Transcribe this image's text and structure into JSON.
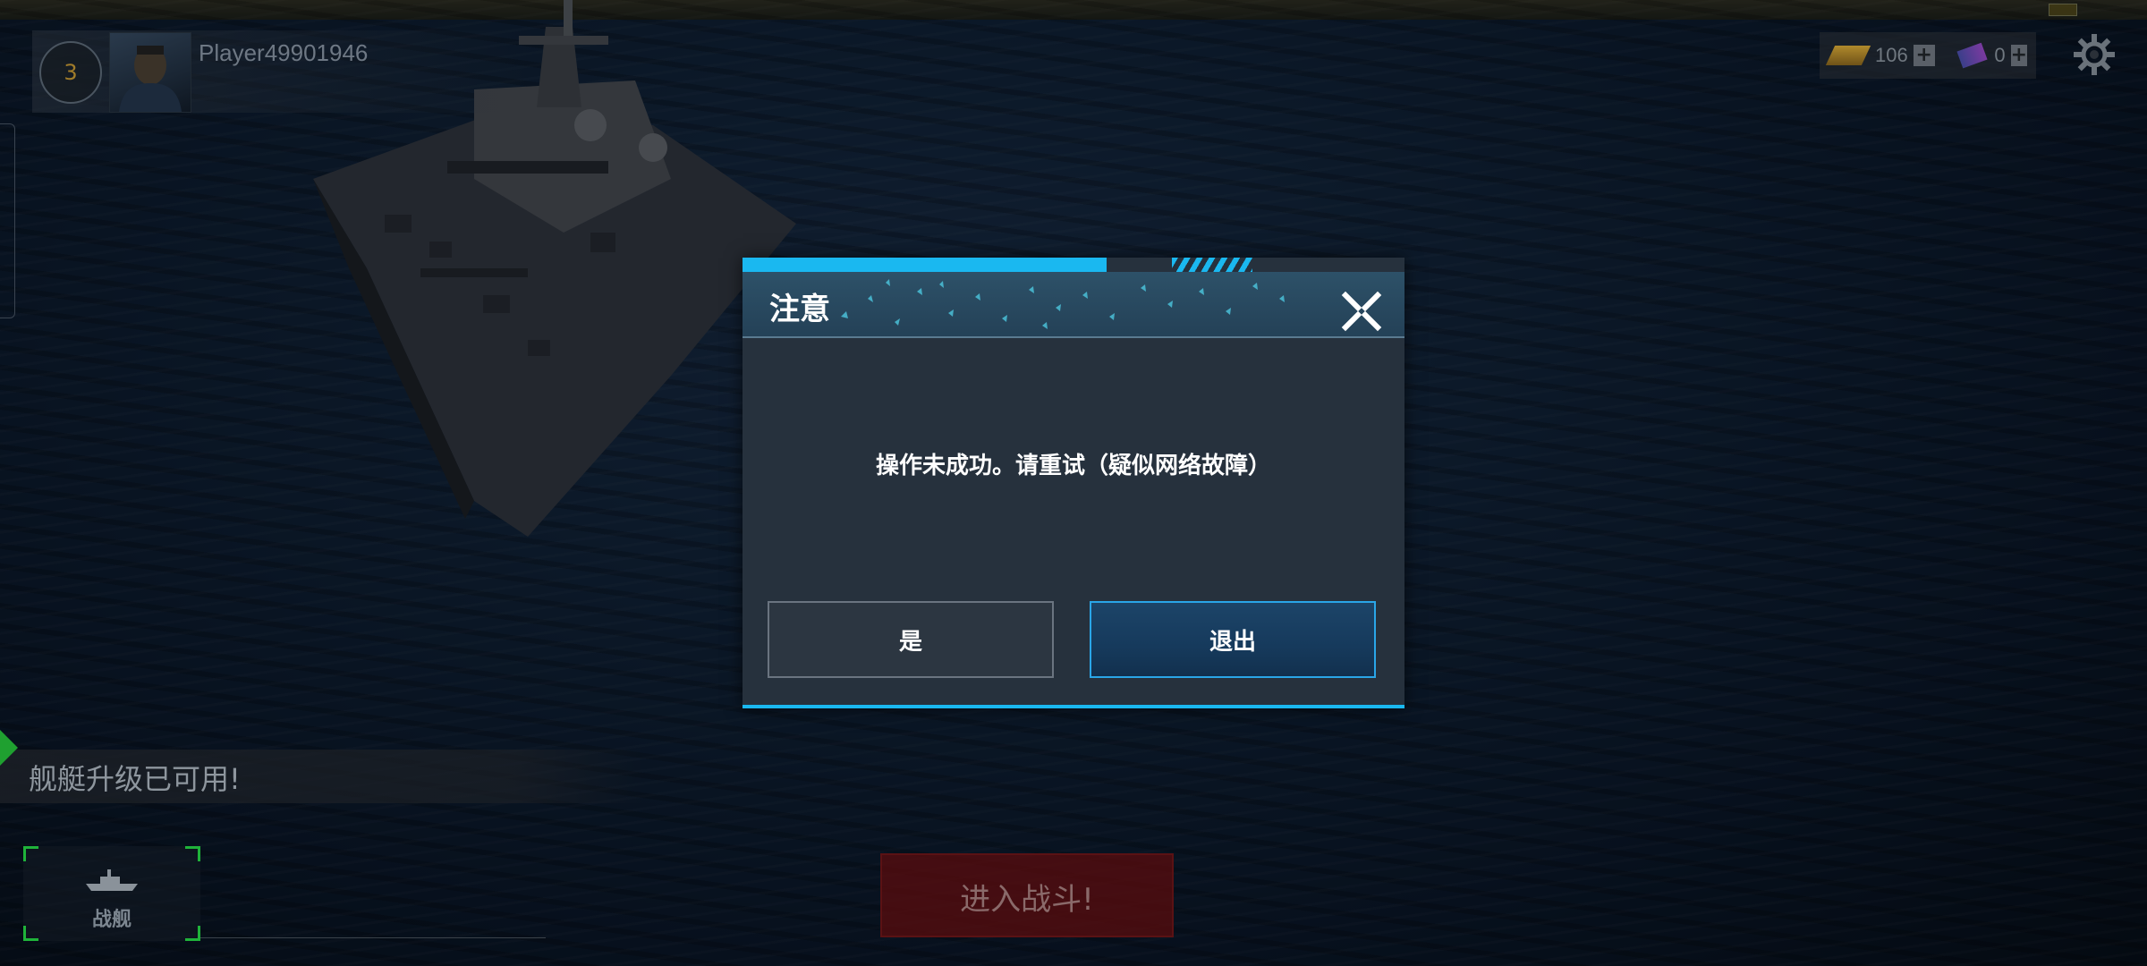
{
  "player": {
    "level": "3",
    "name": "Player49901946"
  },
  "currency": {
    "gold": "106",
    "gems": "0"
  },
  "icons": {
    "gold": "gold-bar-icon",
    "gems": "gem-icon",
    "settings": "gear-icon",
    "close": "close-icon",
    "warship": "warship-icon"
  },
  "dialog": {
    "title": "注意",
    "message": "操作未成功。请重试（疑似网络故障）",
    "yes_label": "是",
    "exit_label": "退出"
  },
  "upgrade_notice": "舰艇升级已可用!",
  "warship_tab_label": "战舰",
  "battle_button_label": "进入战斗!",
  "colors": {
    "accent": "#1ab8f0",
    "dialog_bg": "#26313d",
    "battle_red": "#5a0c0e",
    "upgrade_green": "#1fa030"
  }
}
